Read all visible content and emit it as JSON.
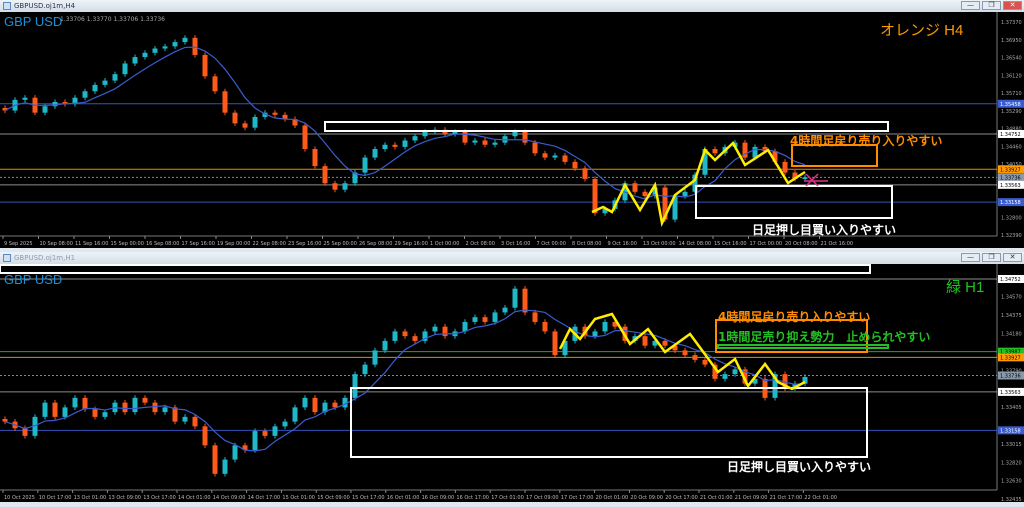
{
  "windows": [
    {
      "title": "GBPUSD.oj1m,H4",
      "symbol": "GBP USD",
      "ohlc": "1.33706 1.33770 1.33706 1.33736",
      "timeframe_label": "オレンジ H4",
      "timeframe_color": "#ff9a00",
      "annotations": {
        "sell": "4時間足戻り売り入りやすい",
        "buy": "日足押し目買い入りやすい"
      }
    },
    {
      "title": "GBPUSD.oj1m,H1",
      "symbol": "GBP USD",
      "timeframe_label": "緑 H1",
      "timeframe_color": "#22c022",
      "annotations": {
        "sell": "4時間足戻り売り入りやすい",
        "resist": "1時間足売り抑え勢力　止められやすい",
        "buy": "日足押し目買い入りやすい"
      }
    }
  ],
  "window_buttons": {
    "minimize": "—",
    "restore": "❐",
    "close": "✕"
  },
  "colors": {
    "bull": "#1fb8c8",
    "bear": "#ff5a1a",
    "ma": "#3a5cd0",
    "zigzag": "#ffee00",
    "background": "#000000"
  },
  "chart_data": [
    {
      "type": "candlestick",
      "symbol": "GBPUSD",
      "timeframe": "H4",
      "ylim": [
        1.3239,
        1.3737
      ],
      "x_ticks": [
        "9 Sep 2025",
        "10 Sep 08:00",
        "11 Sep 16:00",
        "15 Sep 00:00",
        "16 Sep 08:00",
        "17 Sep 16:00",
        "19 Sep 00:00",
        "22 Sep 08:00",
        "23 Sep 16:00",
        "25 Sep 00:00",
        "26 Sep 08:00",
        "29 Sep 16:00",
        "1 Oct 00:00",
        "2 Oct 08:00",
        "3 Oct 16:00",
        "7 Oct 00:00",
        "8 Oct 08:00",
        "9 Oct 16:00",
        "13 Oct 00:00",
        "14 Oct 08:00",
        "15 Oct 16:00",
        "17 Oct 00:00",
        "20 Oct 08:00",
        "21 Oct 16:00"
      ],
      "y_ticks": [
        "1.37370",
        "1.36950",
        "1.36540",
        "1.36120",
        "1.35710",
        "1.35290",
        "1.34880",
        "1.34460",
        "1.34050",
        "1.32800",
        "1.32390"
      ],
      "levels": [
        {
          "price": "1.35458",
          "color": "#3a5cd0"
        },
        {
          "price": "1.34752",
          "color": "#ffffff"
        },
        {
          "price": "1.33927",
          "color": "#ff9a00"
        },
        {
          "price": "1.33736",
          "color": "#8899aa"
        },
        {
          "price": "1.33563",
          "color": "#ffffff"
        },
        {
          "price": "1.33158",
          "color": "#3a5cd0"
        }
      ],
      "closes": [
        1.353,
        1.3555,
        1.356,
        1.3525,
        1.354,
        1.355,
        1.3545,
        1.356,
        1.3575,
        1.359,
        1.36,
        1.3615,
        1.364,
        1.3655,
        1.3665,
        1.3675,
        1.368,
        1.369,
        1.37,
        1.366,
        1.361,
        1.3575,
        1.3525,
        1.35,
        1.349,
        1.3515,
        1.3525,
        1.352,
        1.351,
        1.3495,
        1.344,
        1.34,
        1.336,
        1.3345,
        1.336,
        1.3385,
        1.342,
        1.344,
        1.345,
        1.3445,
        1.346,
        1.347,
        1.348,
        1.3485,
        1.3475,
        1.348,
        1.3455,
        1.346,
        1.345,
        1.3455,
        1.347,
        1.348,
        1.3455,
        1.343,
        1.342,
        1.3425,
        1.341,
        1.3395,
        1.337,
        1.329,
        1.33,
        1.332,
        1.336,
        1.334,
        1.333,
        1.335,
        1.3275,
        1.333,
        1.334,
        1.338,
        1.344,
        1.343,
        1.3445,
        1.3455,
        1.342,
        1.3445,
        1.3435,
        1.341,
        1.3385,
        1.337,
        1.3374
      ]
    },
    {
      "type": "candlestick",
      "symbol": "GBPUSD",
      "timeframe": "H1",
      "ylim": [
        1.32435,
        1.34752
      ],
      "x_ticks": [
        "10 Oct 2025",
        "10 Oct 17:00",
        "13 Oct 01:00",
        "13 Oct 09:00",
        "13 Oct 17:00",
        "14 Oct 01:00",
        "14 Oct 09:00",
        "14 Oct 17:00",
        "15 Oct 01:00",
        "15 Oct 09:00",
        "15 Oct 17:00",
        "16 Oct 01:00",
        "16 Oct 09:00",
        "16 Oct 17:00",
        "17 Oct 01:00",
        "17 Oct 09:00",
        "17 Oct 17:00",
        "20 Oct 01:00",
        "20 Oct 09:00",
        "20 Oct 17:00",
        "21 Oct 01:00",
        "21 Oct 09:00",
        "21 Oct 17:00",
        "22 Oct 01:00"
      ],
      "y_ticks": [
        "1.34570",
        "1.34375",
        "1.34180",
        "1.33790",
        "1.33405",
        "1.33015",
        "1.32820",
        "1.32630",
        "1.32435"
      ],
      "levels": [
        {
          "price": "1.34752",
          "color": "#ffffff"
        },
        {
          "price": "1.33987",
          "color": "#22c022"
        },
        {
          "price": "1.33927",
          "color": "#ff9a00"
        },
        {
          "price": "1.33736",
          "color": "#8899aa"
        },
        {
          "price": "1.33563",
          "color": "#ffffff"
        },
        {
          "price": "1.33158",
          "color": "#3a5cd0"
        }
      ],
      "closes": [
        1.3325,
        1.3318,
        1.331,
        1.333,
        1.3345,
        1.333,
        1.334,
        1.335,
        1.3338,
        1.333,
        1.3335,
        1.3345,
        1.3335,
        1.335,
        1.3345,
        1.3335,
        1.334,
        1.3325,
        1.333,
        1.332,
        1.33,
        1.327,
        1.3285,
        1.33,
        1.3295,
        1.3315,
        1.331,
        1.332,
        1.3325,
        1.334,
        1.335,
        1.3335,
        1.3345,
        1.334,
        1.335,
        1.3375,
        1.3385,
        1.34,
        1.341,
        1.342,
        1.3415,
        1.341,
        1.342,
        1.3425,
        1.3415,
        1.342,
        1.343,
        1.3435,
        1.343,
        1.344,
        1.3445,
        1.3465,
        1.344,
        1.343,
        1.342,
        1.3395,
        1.341,
        1.3425,
        1.3415,
        1.342,
        1.343,
        1.3425,
        1.341,
        1.3415,
        1.3405,
        1.341,
        1.3405,
        1.34,
        1.3395,
        1.339,
        1.3385,
        1.337,
        1.3375,
        1.338,
        1.3365,
        1.337,
        1.335,
        1.3375,
        1.336,
        1.3365,
        1.3372
      ]
    }
  ]
}
